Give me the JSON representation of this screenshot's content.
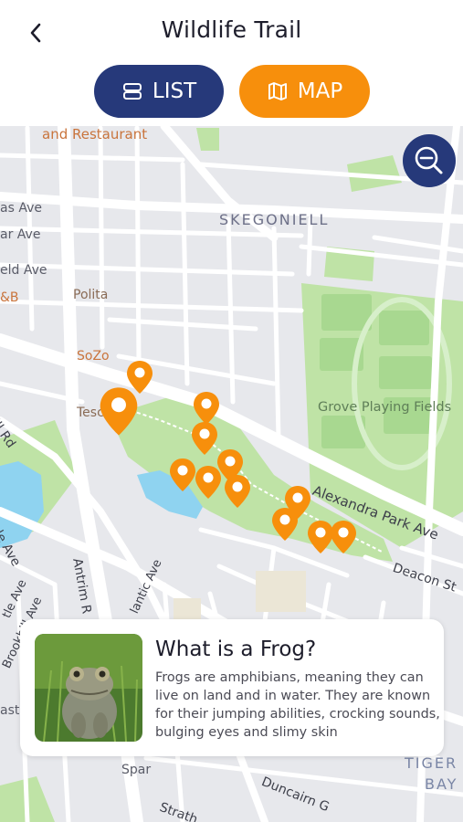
{
  "header": {
    "title": "Wildlife Trail"
  },
  "tabs": [
    {
      "label": "LIST",
      "icon": "list-icon",
      "active": false
    },
    {
      "label": "MAP",
      "icon": "map-icon",
      "active": true
    }
  ],
  "colors": {
    "navy": "#26397a",
    "orange": "#f78f0c",
    "park": "#bfe3a6",
    "water": "#8fd3f0"
  },
  "map": {
    "labels": {
      "restaurant": "and Restaurant",
      "skegoniell": "SKEGONIELL",
      "as_ave": "as Ave",
      "ar_ave": "ar Ave",
      "eld_ave": "eld Ave",
      "b": "&B",
      "polita": "Polita",
      "sozo": "SoZo",
      "tesco": "Tesc",
      "grove": "Grove Playing Fields",
      "alexandra": "Alexandra Park Ave",
      "deacon": "Deacon St",
      "ill_rd": "ill Rd",
      "le_ave": "le Ave",
      "antrim": "Antrim R",
      "lantic": "lantic Ave",
      "tle_ave": "tle Ave",
      "brookhill": "Brookhill Ave",
      "spar": "Spar",
      "duncairn": "Duncairn G",
      "strath": "Strath",
      "tiger": "TIGER",
      "bay": "BAY",
      "ast": "ast"
    },
    "pin_count": 12
  },
  "info_card": {
    "title": "What is a Frog?",
    "body": "Frogs are amphibians, meaning they can live on land and in water. They are known for their jumping abilities, crocking sounds, bulging eyes and slimy skin",
    "image": "frog-photo"
  }
}
